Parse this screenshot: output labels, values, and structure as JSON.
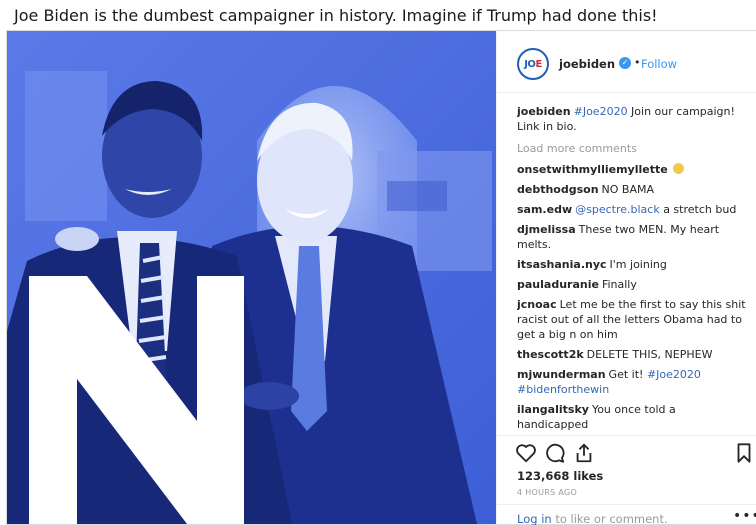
{
  "headline": "Joe Biden is the dumbest campaigner in history. Imagine if Trump had done this!",
  "colors": {
    "tint": "#4d6ee0",
    "follow": "#3897f0",
    "link": "#3468b5",
    "muted": "#999999",
    "avatar_ring": "#1f5fb8",
    "avatar_e": "#e0242f"
  },
  "post": {
    "avatar": {
      "jo": "JO",
      "e": "E"
    },
    "username": "joebiden",
    "verified_icon": "check-icon",
    "dot": "•",
    "follow_label": "Follow",
    "caption": {
      "user": "joebiden",
      "hashtag": "#Joe2020",
      "text": " Join our campaign! Link in bio."
    },
    "load_more": "Load more comments",
    "comments": [
      {
        "user": "onsetwithmylliemyllette",
        "text": "",
        "emoji": "smiling-face"
      },
      {
        "user": "debthodgson",
        "text": "NO BAMA"
      },
      {
        "user": "sam.edw",
        "link": "@spectre.black",
        "text": " a stretch bud"
      },
      {
        "user": "djmelissa",
        "text": "These two MEN. My heart melts."
      },
      {
        "user": "itsashania.nyc",
        "text": "I'm joining"
      },
      {
        "user": "pauladuranie",
        "text": "Finally"
      },
      {
        "user": "jcnoac",
        "text": "Let me be the first to say this shit racist out of all the letters Obama had to get a big n on him"
      },
      {
        "user": "thescott2k",
        "text": "DELETE THIS, NEPHEW"
      },
      {
        "user": "mjwunderman",
        "text": "Get it! ",
        "link": "#Joe2020",
        "link2": "#bidenforthewin"
      },
      {
        "user": "ilangalitsky",
        "text": "You once told a handicapped"
      }
    ],
    "likes": "123,668 likes",
    "time": "4 HOURS AGO",
    "login_link": "Log in",
    "login_rest": " to like or comment.",
    "more": "•••"
  }
}
